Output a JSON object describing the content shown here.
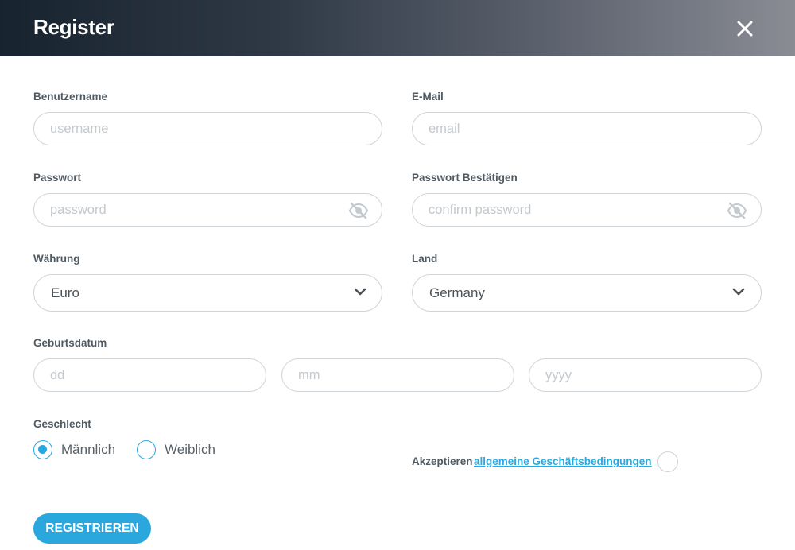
{
  "header": {
    "title": "Register",
    "close_icon": "close-icon"
  },
  "form": {
    "username": {
      "label": "Benutzername",
      "placeholder": "username",
      "value": ""
    },
    "email": {
      "label": "E-Mail",
      "placeholder": "email",
      "value": ""
    },
    "password": {
      "label": "Passwort",
      "placeholder": "password",
      "value": "",
      "icon": "eye-slash-icon"
    },
    "confirm_password": {
      "label": "Passwort Bestätigen",
      "placeholder": "confirm password",
      "value": "",
      "icon": "eye-slash-icon"
    },
    "currency": {
      "label": "Währung",
      "selected": "Euro",
      "icon": "chevron-down-icon"
    },
    "country": {
      "label": "Land",
      "selected": "Germany",
      "icon": "chevron-down-icon"
    },
    "birthdate": {
      "label": "Geburtsdatum",
      "day_placeholder": "dd",
      "month_placeholder": "mm",
      "year_placeholder": "yyyy"
    },
    "gender": {
      "label": "Geschlecht",
      "options": [
        {
          "label": "Männlich",
          "checked": true
        },
        {
          "label": "Weiblich",
          "checked": false
        }
      ]
    },
    "terms": {
      "prefix": "Akzeptieren",
      "link_text": "allgemeine Geschäftsbedingungen",
      "accepted": false
    },
    "submit_label": "REGISTRIEREN"
  },
  "colors": {
    "accent": "#2aa8de",
    "header_start": "#17232f",
    "header_end": "#8a8c94",
    "border": "#cfd4d8",
    "label": "#505a62",
    "placeholder": "#c4c9cd"
  }
}
